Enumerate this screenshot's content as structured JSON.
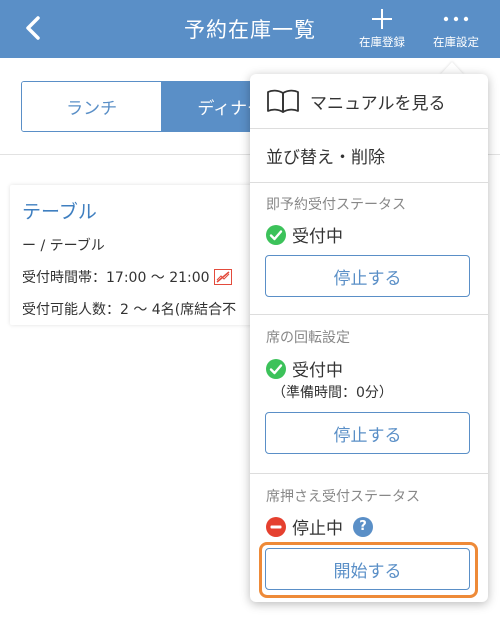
{
  "header": {
    "title": "予約在庫一覧",
    "register_label": "在庫登録",
    "settings_label": "在庫設定",
    "bg_color": "#5a8fc7"
  },
  "tabs": [
    {
      "label": "ランチ",
      "selected": false
    },
    {
      "label": "ディナー",
      "selected": true
    }
  ],
  "card": {
    "title": "テーブル",
    "type_line": "ー / テーブル",
    "time_line": "受付時間帯：17:00 〜 21:00",
    "capacity_line": "受付可能人数：2 〜 4名(席結合不"
  },
  "popup": {
    "manual_label": "マニュアルを見る",
    "sort_label": "並び替え・削除",
    "instant": {
      "title": "即予約受付ステータス",
      "status": "受付中",
      "button": "停止する"
    },
    "rotation": {
      "title": "席の回転設定",
      "status": "受付中",
      "note": "（準備時間：0分）",
      "button": "停止する"
    },
    "hold": {
      "title": "席押さえ受付ステータス",
      "status": "停止中",
      "help": "?",
      "button": "開始する"
    }
  },
  "colors": {
    "accent": "#5a8fc7",
    "ok_green": "#3cc25a",
    "stop_red": "#e5402f",
    "highlight_orange": "#ee8a38"
  }
}
